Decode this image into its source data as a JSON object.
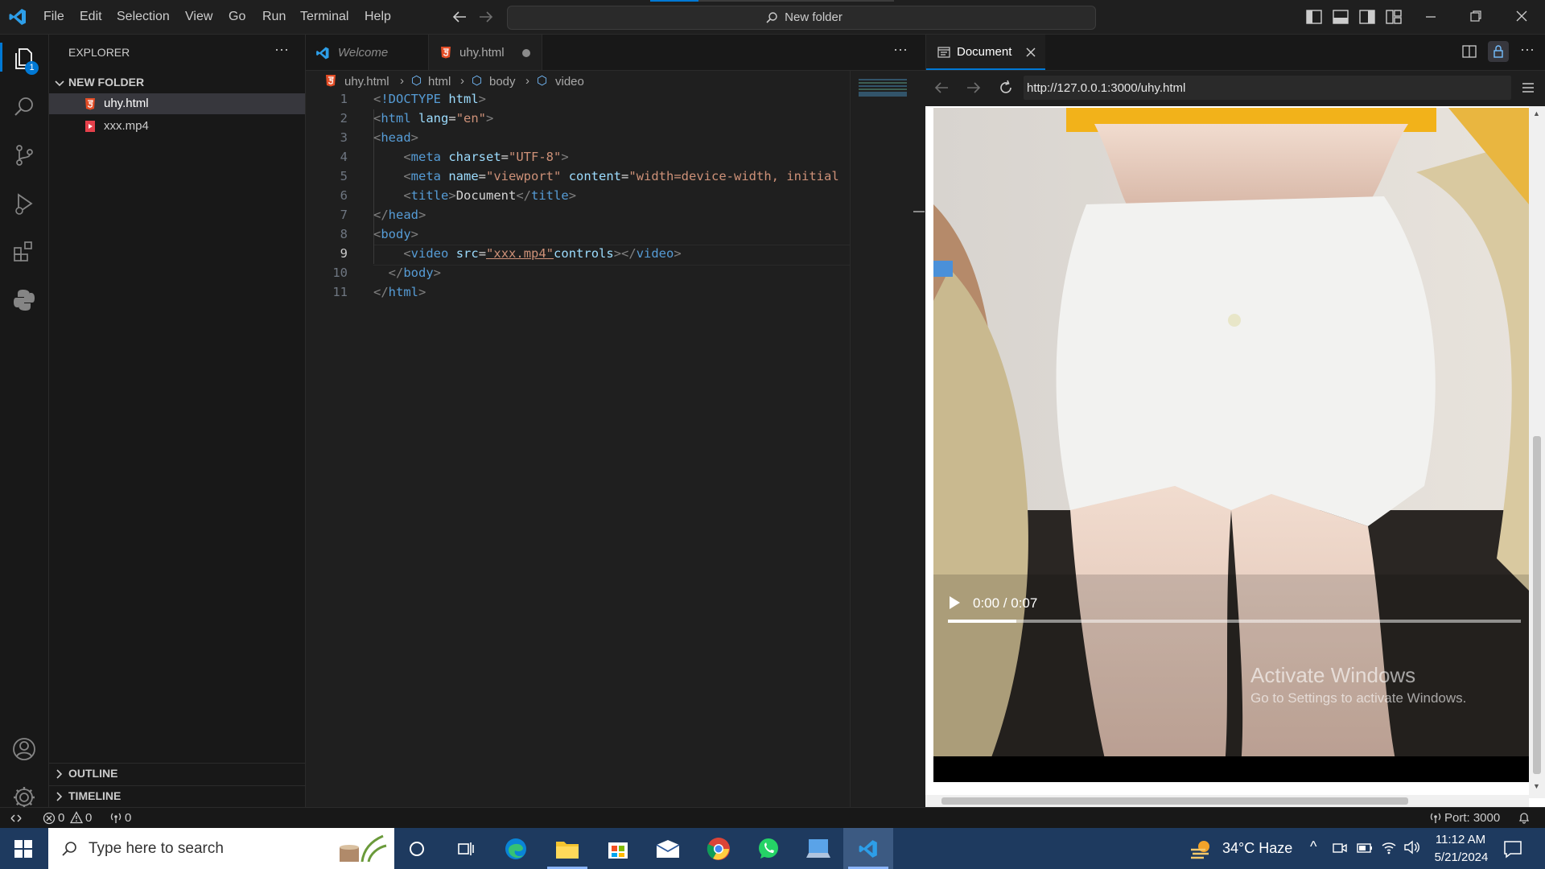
{
  "menu": [
    "File",
    "Edit",
    "Selection",
    "View",
    "Go",
    "Run",
    "Terminal",
    "Help"
  ],
  "command_center": "New folder",
  "sidebar": {
    "title": "EXPLORER",
    "folder": "NEW FOLDER",
    "files": [
      "uhy.html",
      "xxx.mp4"
    ],
    "outline": "OUTLINE",
    "timeline": "TIMELINE",
    "badge": "1"
  },
  "editor": {
    "tabs": [
      {
        "label": "Welcome"
      },
      {
        "label": "uhy.html"
      }
    ],
    "breadcrumb": [
      "uhy.html",
      "html",
      "body",
      "video"
    ],
    "lines": [
      {
        "n": "1",
        "parts": [
          [
            "br",
            "<"
          ],
          [
            "tag",
            "!DOCTYPE"
          ],
          [
            "txt",
            " "
          ],
          [
            "attr",
            "html"
          ],
          [
            "br",
            ">"
          ]
        ]
      },
      {
        "n": "2",
        "parts": [
          [
            "br",
            "<"
          ],
          [
            "tag",
            "html"
          ],
          [
            "txt",
            " "
          ],
          [
            "attr",
            "lang"
          ],
          [
            "txt",
            "="
          ],
          [
            "str",
            "\"en\""
          ],
          [
            "br",
            ">"
          ]
        ]
      },
      {
        "n": "3",
        "parts": [
          [
            "br",
            "<"
          ],
          [
            "tag",
            "head"
          ],
          [
            "br",
            ">"
          ]
        ]
      },
      {
        "n": "4",
        "parts": [
          [
            "txt",
            "    "
          ],
          [
            "br",
            "<"
          ],
          [
            "tag",
            "meta"
          ],
          [
            "txt",
            " "
          ],
          [
            "attr",
            "charset"
          ],
          [
            "txt",
            "="
          ],
          [
            "str",
            "\"UTF-8\""
          ],
          [
            "br",
            ">"
          ]
        ]
      },
      {
        "n": "5",
        "parts": [
          [
            "txt",
            "    "
          ],
          [
            "br",
            "<"
          ],
          [
            "tag",
            "meta"
          ],
          [
            "txt",
            " "
          ],
          [
            "attr",
            "name"
          ],
          [
            "txt",
            "="
          ],
          [
            "str",
            "\"viewport\""
          ],
          [
            "txt",
            " "
          ],
          [
            "attr",
            "content"
          ],
          [
            "txt",
            "="
          ],
          [
            "str",
            "\"width=device-width, initial"
          ]
        ]
      },
      {
        "n": "6",
        "parts": [
          [
            "txt",
            "    "
          ],
          [
            "br",
            "<"
          ],
          [
            "tag",
            "title"
          ],
          [
            "br",
            ">"
          ],
          [
            "txt",
            "Document"
          ],
          [
            "br",
            "</"
          ],
          [
            "tag",
            "title"
          ],
          [
            "br",
            ">"
          ]
        ]
      },
      {
        "n": "7",
        "parts": [
          [
            "br",
            "</"
          ],
          [
            "tag",
            "head"
          ],
          [
            "br",
            ">"
          ]
        ]
      },
      {
        "n": "8",
        "parts": [
          [
            "br",
            "<"
          ],
          [
            "tag",
            "body"
          ],
          [
            "br",
            ">"
          ]
        ]
      },
      {
        "n": "9",
        "parts": [
          [
            "txt",
            "    "
          ],
          [
            "br",
            "<"
          ],
          [
            "tag",
            "video"
          ],
          [
            "txt",
            " "
          ],
          [
            "attr",
            "src"
          ],
          [
            "txt",
            "="
          ],
          [
            "str",
            "\"xxx.mp4\""
          ],
          [
            "attr",
            "controls"
          ],
          [
            "br",
            "></"
          ],
          [
            "tag",
            "video"
          ],
          [
            "br",
            ">"
          ]
        ]
      },
      {
        "n": "10",
        "parts": [
          [
            "txt",
            "  "
          ],
          [
            "br",
            "</"
          ],
          [
            "tag",
            "body"
          ],
          [
            "br",
            ">"
          ]
        ]
      },
      {
        "n": "11",
        "parts": [
          [
            "br",
            "</"
          ],
          [
            "tag",
            "html"
          ],
          [
            "br",
            ">"
          ]
        ]
      }
    ],
    "active_line": "9"
  },
  "preview": {
    "tab": "Document",
    "url": "http://127.0.0.1:3000/uhy.html",
    "video_time": "0:00 / 0:07",
    "video_progress": 0.12,
    "watermark_title": "Activate Windows",
    "watermark_sub": "Go to Settings to activate Windows."
  },
  "status": {
    "errors": "0",
    "warnings": "0",
    "ports": "0",
    "port": "Port: 3000"
  },
  "taskbar": {
    "search": "Type here to search",
    "weather": "34°C  Haze",
    "time": "11:12 AM",
    "date": "5/21/2024"
  },
  "colors": {
    "accent": "#0078d4",
    "tag": "#569cd6",
    "attr": "#9cdcfe",
    "string": "#ce9178",
    "taskbar": "#1e3a5f"
  }
}
